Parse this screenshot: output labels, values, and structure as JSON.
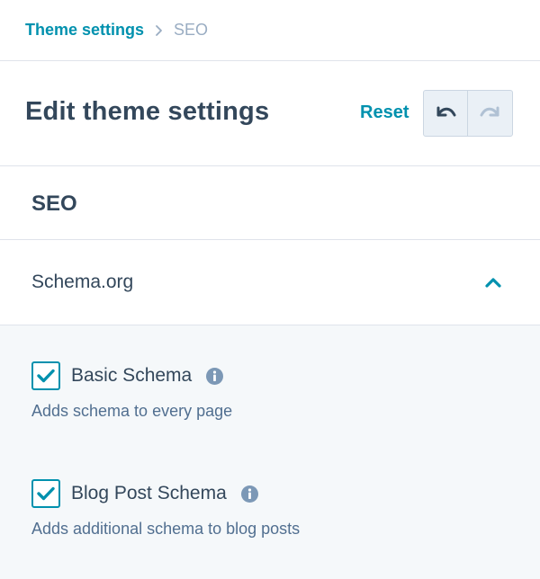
{
  "breadcrumb": {
    "parent": "Theme settings",
    "current": "SEO"
  },
  "header": {
    "title": "Edit theme settings",
    "reset_label": "Reset",
    "undo_icon": "undo-icon",
    "redo_icon": "redo-icon"
  },
  "section": {
    "title": "SEO"
  },
  "accordion": {
    "title": "Schema.org",
    "expanded": true,
    "fields": [
      {
        "label": "Basic Schema",
        "help": "Adds schema to every page",
        "checked": true
      },
      {
        "label": "Blog Post Schema",
        "help": "Adds additional schema to blog posts",
        "checked": true
      }
    ]
  },
  "colors": {
    "accent": "#0091ae",
    "text": "#33475b",
    "muted": "#99acc2",
    "panel": "#f5f8fa",
    "border": "#dfe3eb"
  }
}
